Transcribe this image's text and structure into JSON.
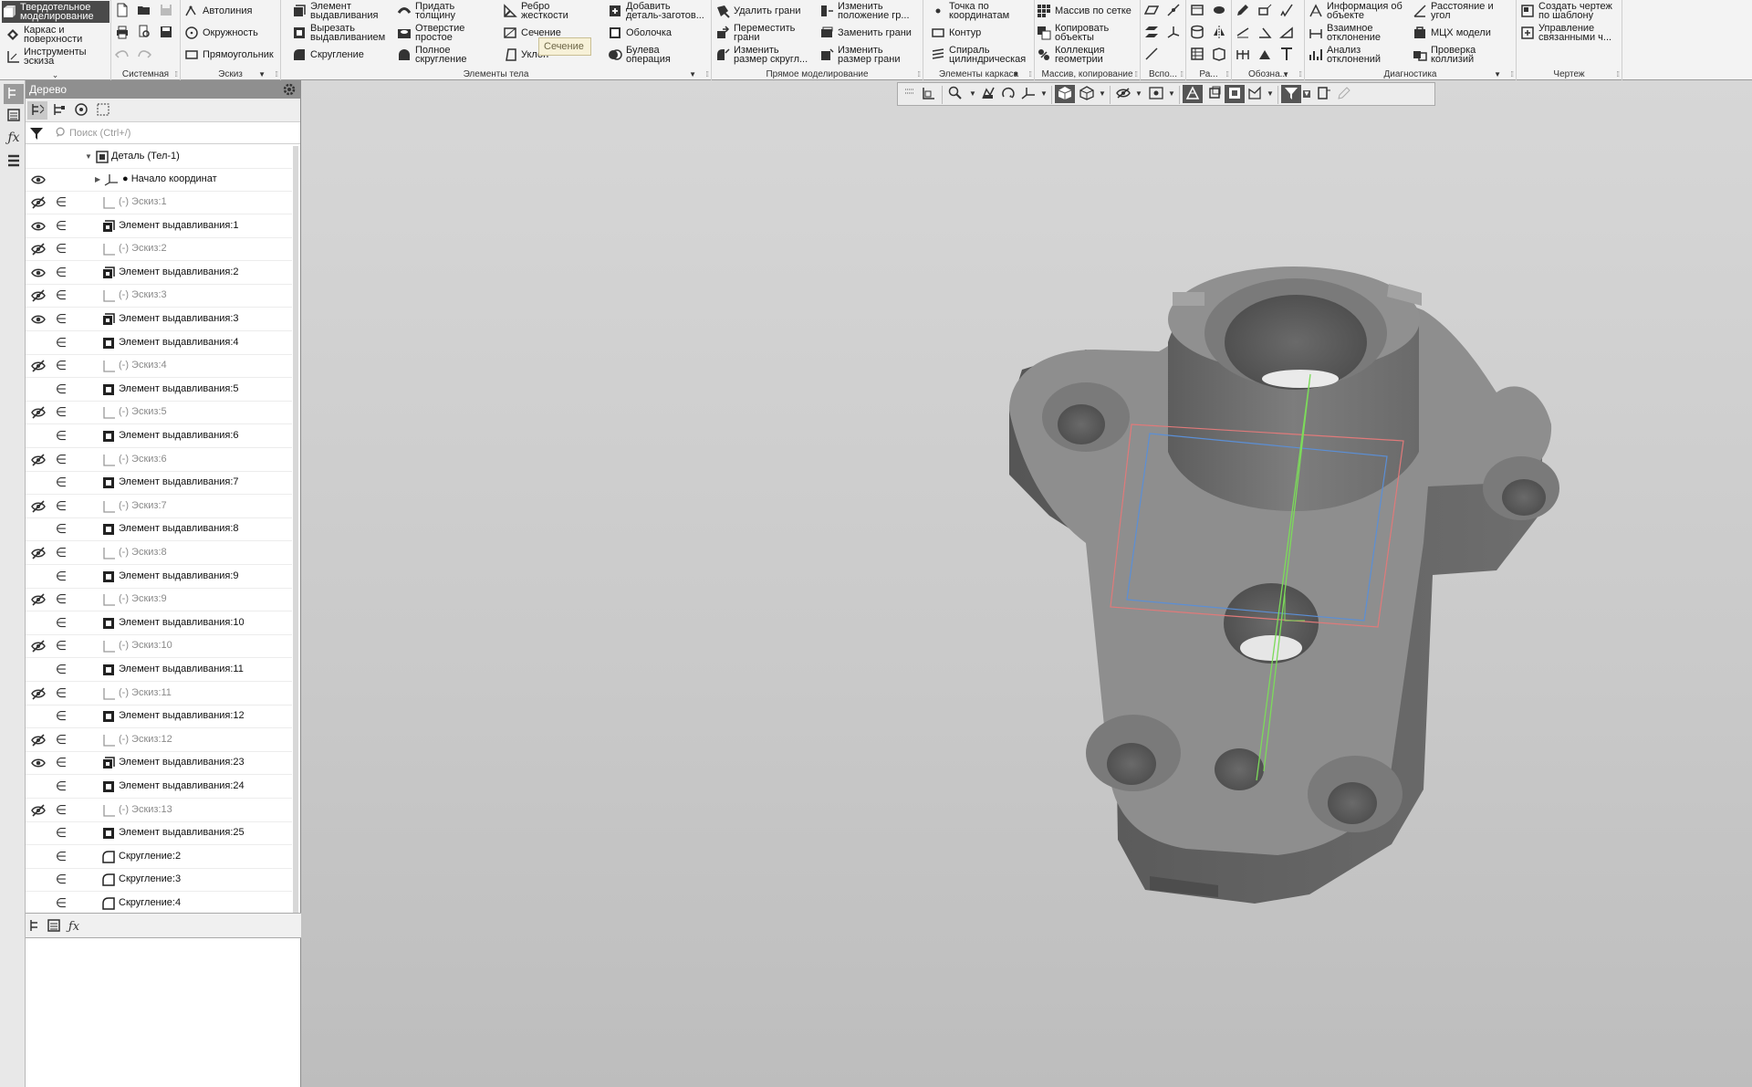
{
  "ribbon": {
    "mode_buttons": [
      {
        "label": "Твердотельное\nмоделирование",
        "icon": "solid-modeling-icon"
      },
      {
        "label": "Каркас и\nповерхности",
        "icon": "wireframe-icon"
      },
      {
        "label": "Инструменты\nэскиза",
        "icon": "sketch-tools-icon"
      }
    ],
    "groups": {
      "system": "Системная",
      "sketch": "Эскиз",
      "body": "Элементы тела",
      "direct": "Прямое моделирование",
      "frame": "Элементы каркаса",
      "array": "Массив, копирование",
      "aux": "Вспо...",
      "ra": "Ра...",
      "notation": "Обозна...",
      "diag": "Диагностика",
      "drawing": "Чертеж"
    },
    "sketch_buttons": [
      "Автолиния",
      "Окружность",
      "Прямоугольник"
    ],
    "body_buttons_col1": [
      "Элемент\nвыдавливания",
      "Вырезать\nвыдавливанием",
      "Скругление"
    ],
    "body_buttons_col2": [
      "Придать\nтолщину",
      "Отверстие\nпростое",
      "Полное\nскругление"
    ],
    "body_buttons_col3": [
      "Ребро\nжесткости",
      "Сечение",
      "Уклон"
    ],
    "body_buttons_col4": [
      "Добавить\nдеталь-заготов...",
      "Оболочка",
      "Булева\nоперация"
    ],
    "direct_col1": [
      "Удалить грани",
      "Переместить\nграни",
      "Изменить\nразмер скругл..."
    ],
    "direct_col2": [
      "Изменить\nположение гр...",
      "Заменить грани",
      "Изменить\nразмер грани"
    ],
    "frame_col": [
      "Точка по\nкоординатам",
      "Контур",
      "Спираль\nцилиндрическая"
    ],
    "array_col": [
      "Массив по сетке",
      "Копировать\nобъекты",
      "Коллекция\nгеометрии"
    ],
    "diag_col1": [
      "Информация об\nобъекте",
      "Взаимное\nотклонение",
      "Анализ\nотклонений"
    ],
    "diag_col2": [
      "Расстояние и\nугол",
      "МЦХ модели",
      "Проверка\nколлизий"
    ],
    "drawing_col": [
      "Создать чертеж\nпо шаблону",
      "Управление\nсвязанными ч..."
    ],
    "tooltip": "Сечение"
  },
  "tree": {
    "title": "Дерево",
    "search_placeholder": "Поиск (Ctrl+/)",
    "root": "Деталь (Тел-1)",
    "origin": "Начало координат",
    "items": [
      {
        "label": "(-) Эскиз:1",
        "type": "sketch",
        "eye": "hidden"
      },
      {
        "label": "Элемент выдавливания:1",
        "type": "extrude",
        "eye": "visible"
      },
      {
        "label": "(-) Эскиз:2",
        "type": "sketch",
        "eye": "hidden"
      },
      {
        "label": "Элемент выдавливания:2",
        "type": "extrude",
        "eye": "visible"
      },
      {
        "label": "(-) Эскиз:3",
        "type": "sketch",
        "eye": "hidden"
      },
      {
        "label": "Элемент выдавливания:3",
        "type": "extrude",
        "eye": "visible"
      },
      {
        "label": "Элемент выдавливания:4",
        "type": "extrude-cut",
        "eye": "none"
      },
      {
        "label": "(-) Эскиз:4",
        "type": "sketch",
        "eye": "hidden"
      },
      {
        "label": "Элемент выдавливания:5",
        "type": "extrude-cut",
        "eye": "none"
      },
      {
        "label": "(-) Эскиз:5",
        "type": "sketch",
        "eye": "hidden"
      },
      {
        "label": "Элемент выдавливания:6",
        "type": "extrude-cut",
        "eye": "none"
      },
      {
        "label": "(-) Эскиз:6",
        "type": "sketch",
        "eye": "hidden"
      },
      {
        "label": "Элемент выдавливания:7",
        "type": "extrude-cut",
        "eye": "none"
      },
      {
        "label": "(-) Эскиз:7",
        "type": "sketch",
        "eye": "hidden"
      },
      {
        "label": "Элемент выдавливания:8",
        "type": "extrude-cut",
        "eye": "none"
      },
      {
        "label": "(-) Эскиз:8",
        "type": "sketch",
        "eye": "hidden"
      },
      {
        "label": "Элемент выдавливания:9",
        "type": "extrude-cut",
        "eye": "none"
      },
      {
        "label": "(-) Эскиз:9",
        "type": "sketch",
        "eye": "hidden"
      },
      {
        "label": "Элемент выдавливания:10",
        "type": "extrude-cut",
        "eye": "none"
      },
      {
        "label": "(-) Эскиз:10",
        "type": "sketch",
        "eye": "hidden"
      },
      {
        "label": "Элемент выдавливания:11",
        "type": "extrude-cut",
        "eye": "none"
      },
      {
        "label": "(-) Эскиз:11",
        "type": "sketch",
        "eye": "hidden"
      },
      {
        "label": "Элемент выдавливания:12",
        "type": "extrude-cut",
        "eye": "none"
      },
      {
        "label": "(-) Эскиз:12",
        "type": "sketch",
        "eye": "hidden"
      },
      {
        "label": "Элемент выдавливания:23",
        "type": "extrude",
        "eye": "visible"
      },
      {
        "label": "Элемент выдавливания:24",
        "type": "extrude-cut",
        "eye": "none"
      },
      {
        "label": "(-) Эскиз:13",
        "type": "sketch",
        "eye": "hidden"
      },
      {
        "label": "Элемент выдавливания:25",
        "type": "extrude-cut",
        "eye": "none"
      },
      {
        "label": "Скругление:2",
        "type": "fillet",
        "eye": "none"
      },
      {
        "label": "Скругление:3",
        "type": "fillet",
        "eye": "none"
      },
      {
        "label": "Скругление:4",
        "type": "fillet",
        "eye": "none"
      }
    ]
  },
  "colors": {
    "ribbon_bg": "#f3f3f3",
    "tree_title_bg": "#8f8f8f",
    "viewport_bg": "#cbcbcb",
    "model_face": "#8a8a8a",
    "model_side": "#5f5f5f",
    "sketch_red": "#e07a7a",
    "sketch_blue": "#5b8fd6",
    "axis_green": "#7cdb5a"
  }
}
